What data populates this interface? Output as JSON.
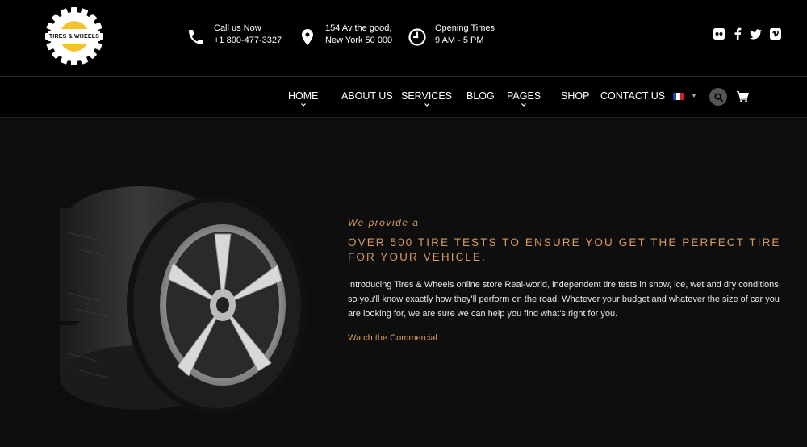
{
  "brand": {
    "logo_text": "TIRES & WHEELS",
    "accent_color": "#d99a5b",
    "logo_accent": "#f2c230"
  },
  "contact": {
    "call": {
      "icon": "phone-icon",
      "line1": "Call us Now",
      "line2": "+1 800-477-3327"
    },
    "address": {
      "icon": "map-pin-icon",
      "line1": "154 Av the good,",
      "line2": "New York 50 000"
    },
    "hours": {
      "icon": "clock-icon",
      "line1": "Opening Times",
      "line2": "9 AM - 5 PM"
    }
  },
  "social": [
    "flickr-icon",
    "facebook-icon",
    "twitter-icon",
    "vimeo-icon"
  ],
  "nav": {
    "items": [
      {
        "label": "HOME",
        "has_dropdown": true
      },
      {
        "label": "ABOUT US",
        "has_dropdown": false
      },
      {
        "label": "SERVICES",
        "has_dropdown": true
      },
      {
        "label": "BLOG",
        "has_dropdown": false
      },
      {
        "label": "PAGES",
        "has_dropdown": true
      },
      {
        "label": "SHOP",
        "has_dropdown": false
      },
      {
        "label": "CONTACT US",
        "has_dropdown": false
      }
    ],
    "language_flag": "french-flag-icon",
    "search_icon": "search-icon",
    "cart_icon": "cart-icon"
  },
  "hero": {
    "kicker": "We provide a",
    "headline": "OVER 500 TIRE TESTS TO ENSURE YOU GET THE PERFECT TIRE FOR YOUR VEHICLE.",
    "description": "Introducing Tires & Wheels online store Real-world, independent tire tests in snow, ice, wet and dry conditions so you'll know exactly how they'll perform on the road. Whatever your budget and whatever the size of car you are looking for, we are sure we can help you find what's right for you.",
    "link_label": "Watch the Commercial"
  }
}
